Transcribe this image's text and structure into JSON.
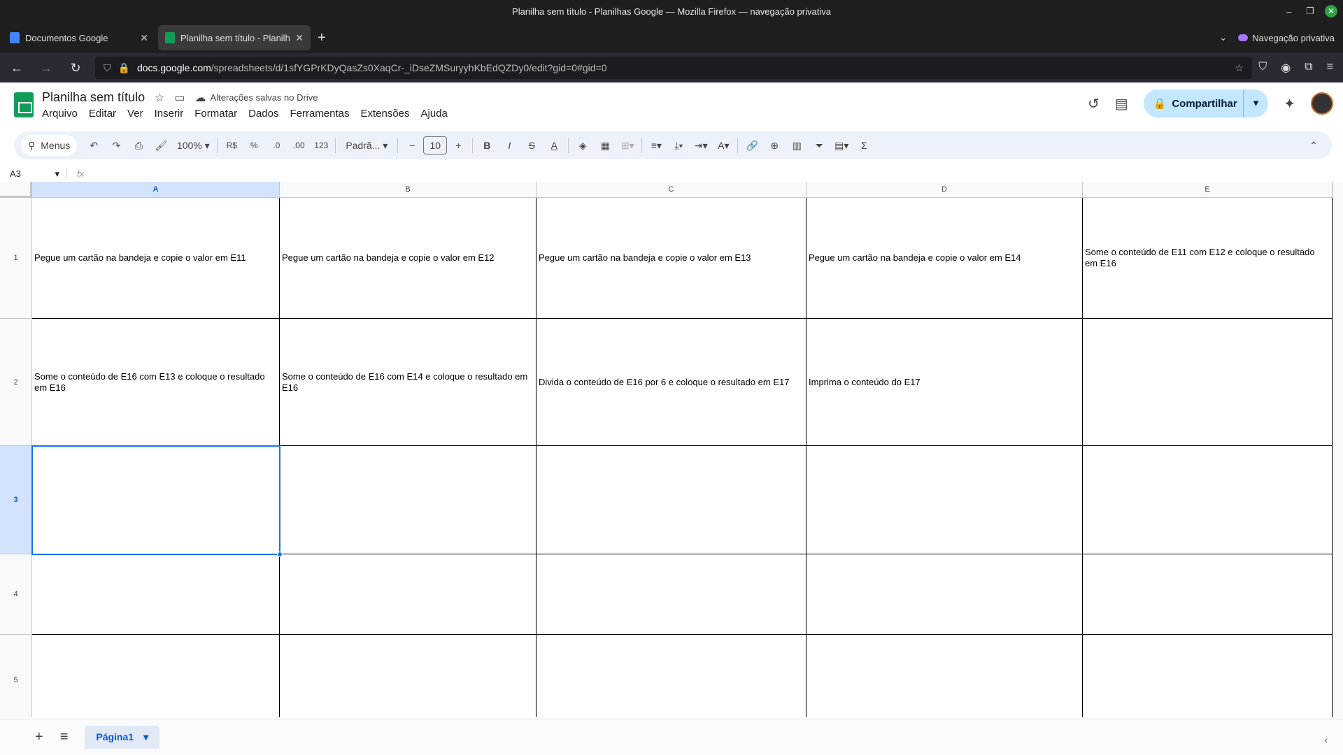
{
  "window": {
    "title": "Planilha sem título - Planilhas Google — Mozilla Firefox — navegação privativa",
    "controls": [
      "–",
      "❐",
      "✕"
    ]
  },
  "tabs": [
    {
      "label": "Documentos Google",
      "color": "#4285f4"
    },
    {
      "label": "Planilha sem título - Planilha",
      "color": "#0f9d58"
    }
  ],
  "private_label": "Navegação privativa",
  "url": {
    "host": "docs.google.com",
    "path": "/spreadsheets/d/1sfYGPrKDyQasZs0XaqCr-_iDseZMSuryyhKbEdQZDy0/edit?gid=0#gid=0"
  },
  "doc": {
    "title": "Planilha sem título",
    "saved_status": "Alterações salvas no Drive",
    "menus": [
      "Arquivo",
      "Editar",
      "Ver",
      "Inserir",
      "Formatar",
      "Dados",
      "Ferramentas",
      "Extensões",
      "Ajuda"
    ],
    "share_label": "Compartilhar"
  },
  "toolbar": {
    "search_label": "Menus",
    "zoom": "100%",
    "currency": "R$",
    "percent": "%",
    "dec_minus": ".0",
    "dec_plus": ".00",
    "number_format": "123",
    "font": "Padrã...",
    "font_size": "10"
  },
  "namebox": "A3",
  "fx": "fx",
  "columns": [
    "A",
    "B",
    "C",
    "D",
    "E"
  ],
  "selected_column": "A",
  "rows": [
    "1",
    "2",
    "3",
    "4",
    "5"
  ],
  "selected_row": "3",
  "cells": [
    [
      "Pegue um cartão na bandeja e copie o valor em E11",
      "Pegue um cartão na bandeja e copie o valor em E12",
      "Pegue um cartão na bandeja e copie o valor em E13",
      "Pegue um cartão na bandeja e copie o valor em E14",
      "Some o conteúdo de E11 com E12 e coloque o resultado em E16"
    ],
    [
      "Some o conteúdo de E16 com E13 e coloque o resultado em E16",
      "Some o conteúdo de E16 com E14 e coloque o resultado em E16",
      "Divida o conteúdo de E16 por 6 e coloque o resultado em E17",
      "Imprima o conteúdo do E17",
      ""
    ],
    [
      "",
      "",
      "",
      "",
      ""
    ],
    [
      "",
      "",
      "",
      "",
      ""
    ],
    [
      "",
      "",
      "",
      "",
      ""
    ]
  ],
  "sheet_tab": "Página1"
}
